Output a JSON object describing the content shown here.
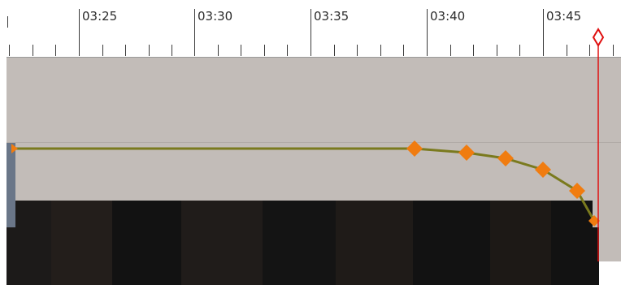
{
  "timeline": {
    "ruler_labels": [
      "03:25",
      "03:30",
      "03:35",
      "03:40",
      "03:45"
    ],
    "playhead_icon": "diamond-marker-icon"
  },
  "clip": {
    "name": "",
    "keyframe_icon": "diamond-keyframe-icon",
    "envelope_color": "#7a7a1e",
    "keyframe_color": "#f07c10"
  },
  "colors": {
    "playhead": "#e01010",
    "track_background": "#c2bcb8",
    "clip_background": "#151515"
  }
}
